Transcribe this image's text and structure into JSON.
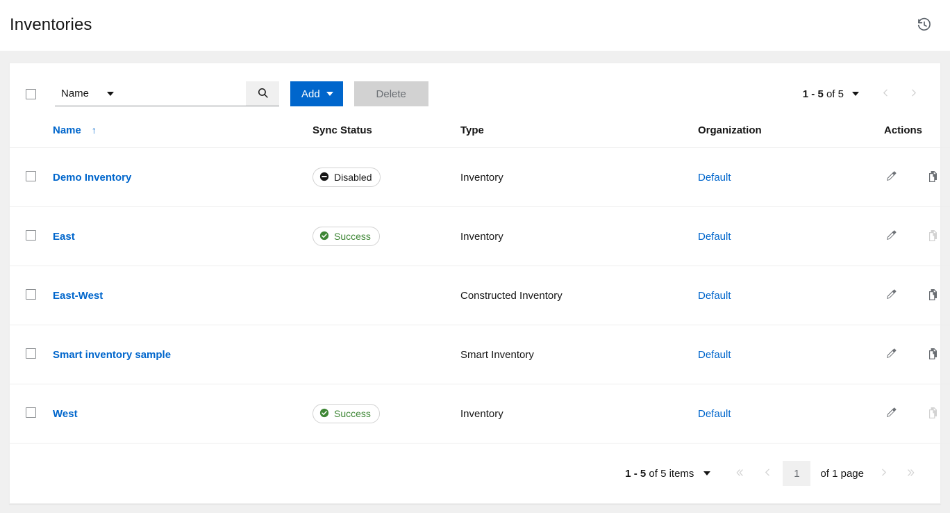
{
  "header": {
    "title": "Inventories",
    "history_icon": "history-icon"
  },
  "toolbar": {
    "select_all_checkbox": "",
    "filter_select": {
      "value": "Name",
      "caret_icon": "chevron-down-icon"
    },
    "search": {
      "value": "",
      "placeholder": "",
      "icon": "search-icon"
    },
    "add_button": {
      "label": "Add",
      "caret_icon": "chevron-down-icon"
    },
    "delete_button": {
      "label": "Delete"
    },
    "pagination": {
      "range": "1 - 5 of 5",
      "range_prefix": "1 - 5",
      "range_suffix": "of 5",
      "caret_icon": "chevron-down-icon",
      "prev_icon": "chevron-left-icon",
      "next_icon": "chevron-right-icon"
    }
  },
  "table": {
    "columns": [
      {
        "label": "Name",
        "sortable": true,
        "sort_direction": "asc",
        "sort_icon": "arrow-up-icon"
      },
      {
        "label": "Sync Status",
        "sortable": false
      },
      {
        "label": "Type",
        "sortable": false
      },
      {
        "label": "Organization",
        "sortable": false
      },
      {
        "label": "Actions",
        "sortable": false
      }
    ],
    "rows": [
      {
        "name": "Demo Inventory",
        "sync_status": {
          "label": "Disabled",
          "variant": "disabled",
          "icon": "minus-circle-icon"
        },
        "type": "Inventory",
        "organization": "Default",
        "actions": {
          "edit": {
            "icon": "pencil-icon",
            "enabled": true
          },
          "copy": {
            "icon": "copy-icon",
            "enabled": true
          }
        }
      },
      {
        "name": "East",
        "sync_status": {
          "label": "Success",
          "variant": "success",
          "icon": "check-circle-icon"
        },
        "type": "Inventory",
        "organization": "Default",
        "actions": {
          "edit": {
            "icon": "pencil-icon",
            "enabled": true
          },
          "copy": {
            "icon": "copy-icon",
            "enabled": false
          }
        }
      },
      {
        "name": "East-West",
        "sync_status": {
          "label": "",
          "variant": "none",
          "icon": ""
        },
        "type": "Constructed Inventory",
        "organization": "Default",
        "actions": {
          "edit": {
            "icon": "pencil-icon",
            "enabled": true
          },
          "copy": {
            "icon": "copy-icon",
            "enabled": true
          }
        }
      },
      {
        "name": "Smart inventory sample",
        "sync_status": {
          "label": "",
          "variant": "none",
          "icon": ""
        },
        "type": "Smart Inventory",
        "organization": "Default",
        "actions": {
          "edit": {
            "icon": "pencil-icon",
            "enabled": true
          },
          "copy": {
            "icon": "copy-icon",
            "enabled": true
          }
        }
      },
      {
        "name": "West",
        "sync_status": {
          "label": "Success",
          "variant": "success",
          "icon": "check-circle-icon"
        },
        "type": "Inventory",
        "organization": "Default",
        "actions": {
          "edit": {
            "icon": "pencil-icon",
            "enabled": true
          },
          "copy": {
            "icon": "copy-icon",
            "enabled": false
          }
        }
      }
    ]
  },
  "footer_pagination": {
    "range_prefix": "1 - 5",
    "range_suffix": "of 5",
    "items_label": "items",
    "caret_icon": "chevron-down-icon",
    "first_icon": "angle-double-left-icon",
    "prev_icon": "chevron-left-icon",
    "page_value": "1",
    "of_pages": "of 1 page",
    "next_icon": "chevron-right-icon",
    "last_icon": "angle-double-right-icon"
  },
  "colors": {
    "link": "#06c",
    "primary_button": "#0066cc",
    "success": "#3e8635",
    "page_background": "#f0f0f0",
    "card_background": "#ffffff",
    "border": "#ededed"
  }
}
